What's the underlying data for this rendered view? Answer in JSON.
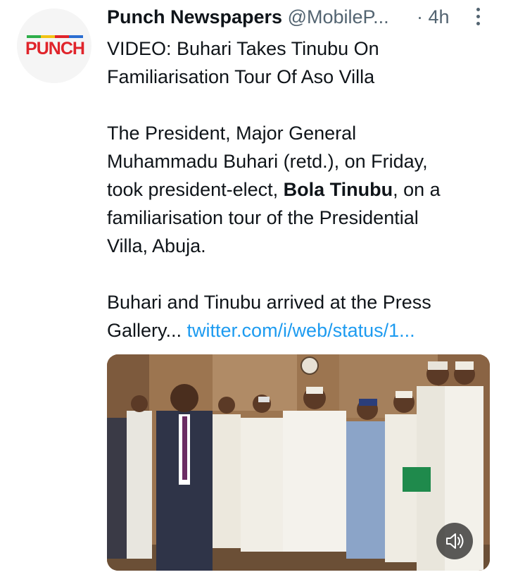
{
  "author": {
    "display_name": "Punch Newspapers",
    "handle": "@MobileP...",
    "time": "· 4h",
    "avatar_logo_text": "PUNCH"
  },
  "tweet": {
    "headline_line1": "VIDEO: Buhari Takes Tinubu On",
    "headline_line2": "Familiarisation Tour Of Aso Villa",
    "para1_line1": "The President, Major General",
    "para1_line2": "Muhammadu Buhari (retd.), on Friday,",
    "para1_line3_pre": "took president-elect, ",
    "para1_line3_bold": "Bola Tinubu",
    "para1_line3_post": ", on a",
    "para1_line4": "familiarisation tour of the Presidential",
    "para1_line5": "Villa, Abuja.",
    "para2_line1": "Buhari and Tinubu arrived at the Press",
    "para2_line2_pre": "Gallery... ",
    "link": "twitter.com/i/web/status/1..."
  },
  "icons": {
    "more": "more-options-icon",
    "volume": "speaker-volume-icon"
  },
  "colors": {
    "text": "#0f1419",
    "secondary": "#536471",
    "link": "#1d9bf0",
    "punch_red": "#e0242b"
  }
}
